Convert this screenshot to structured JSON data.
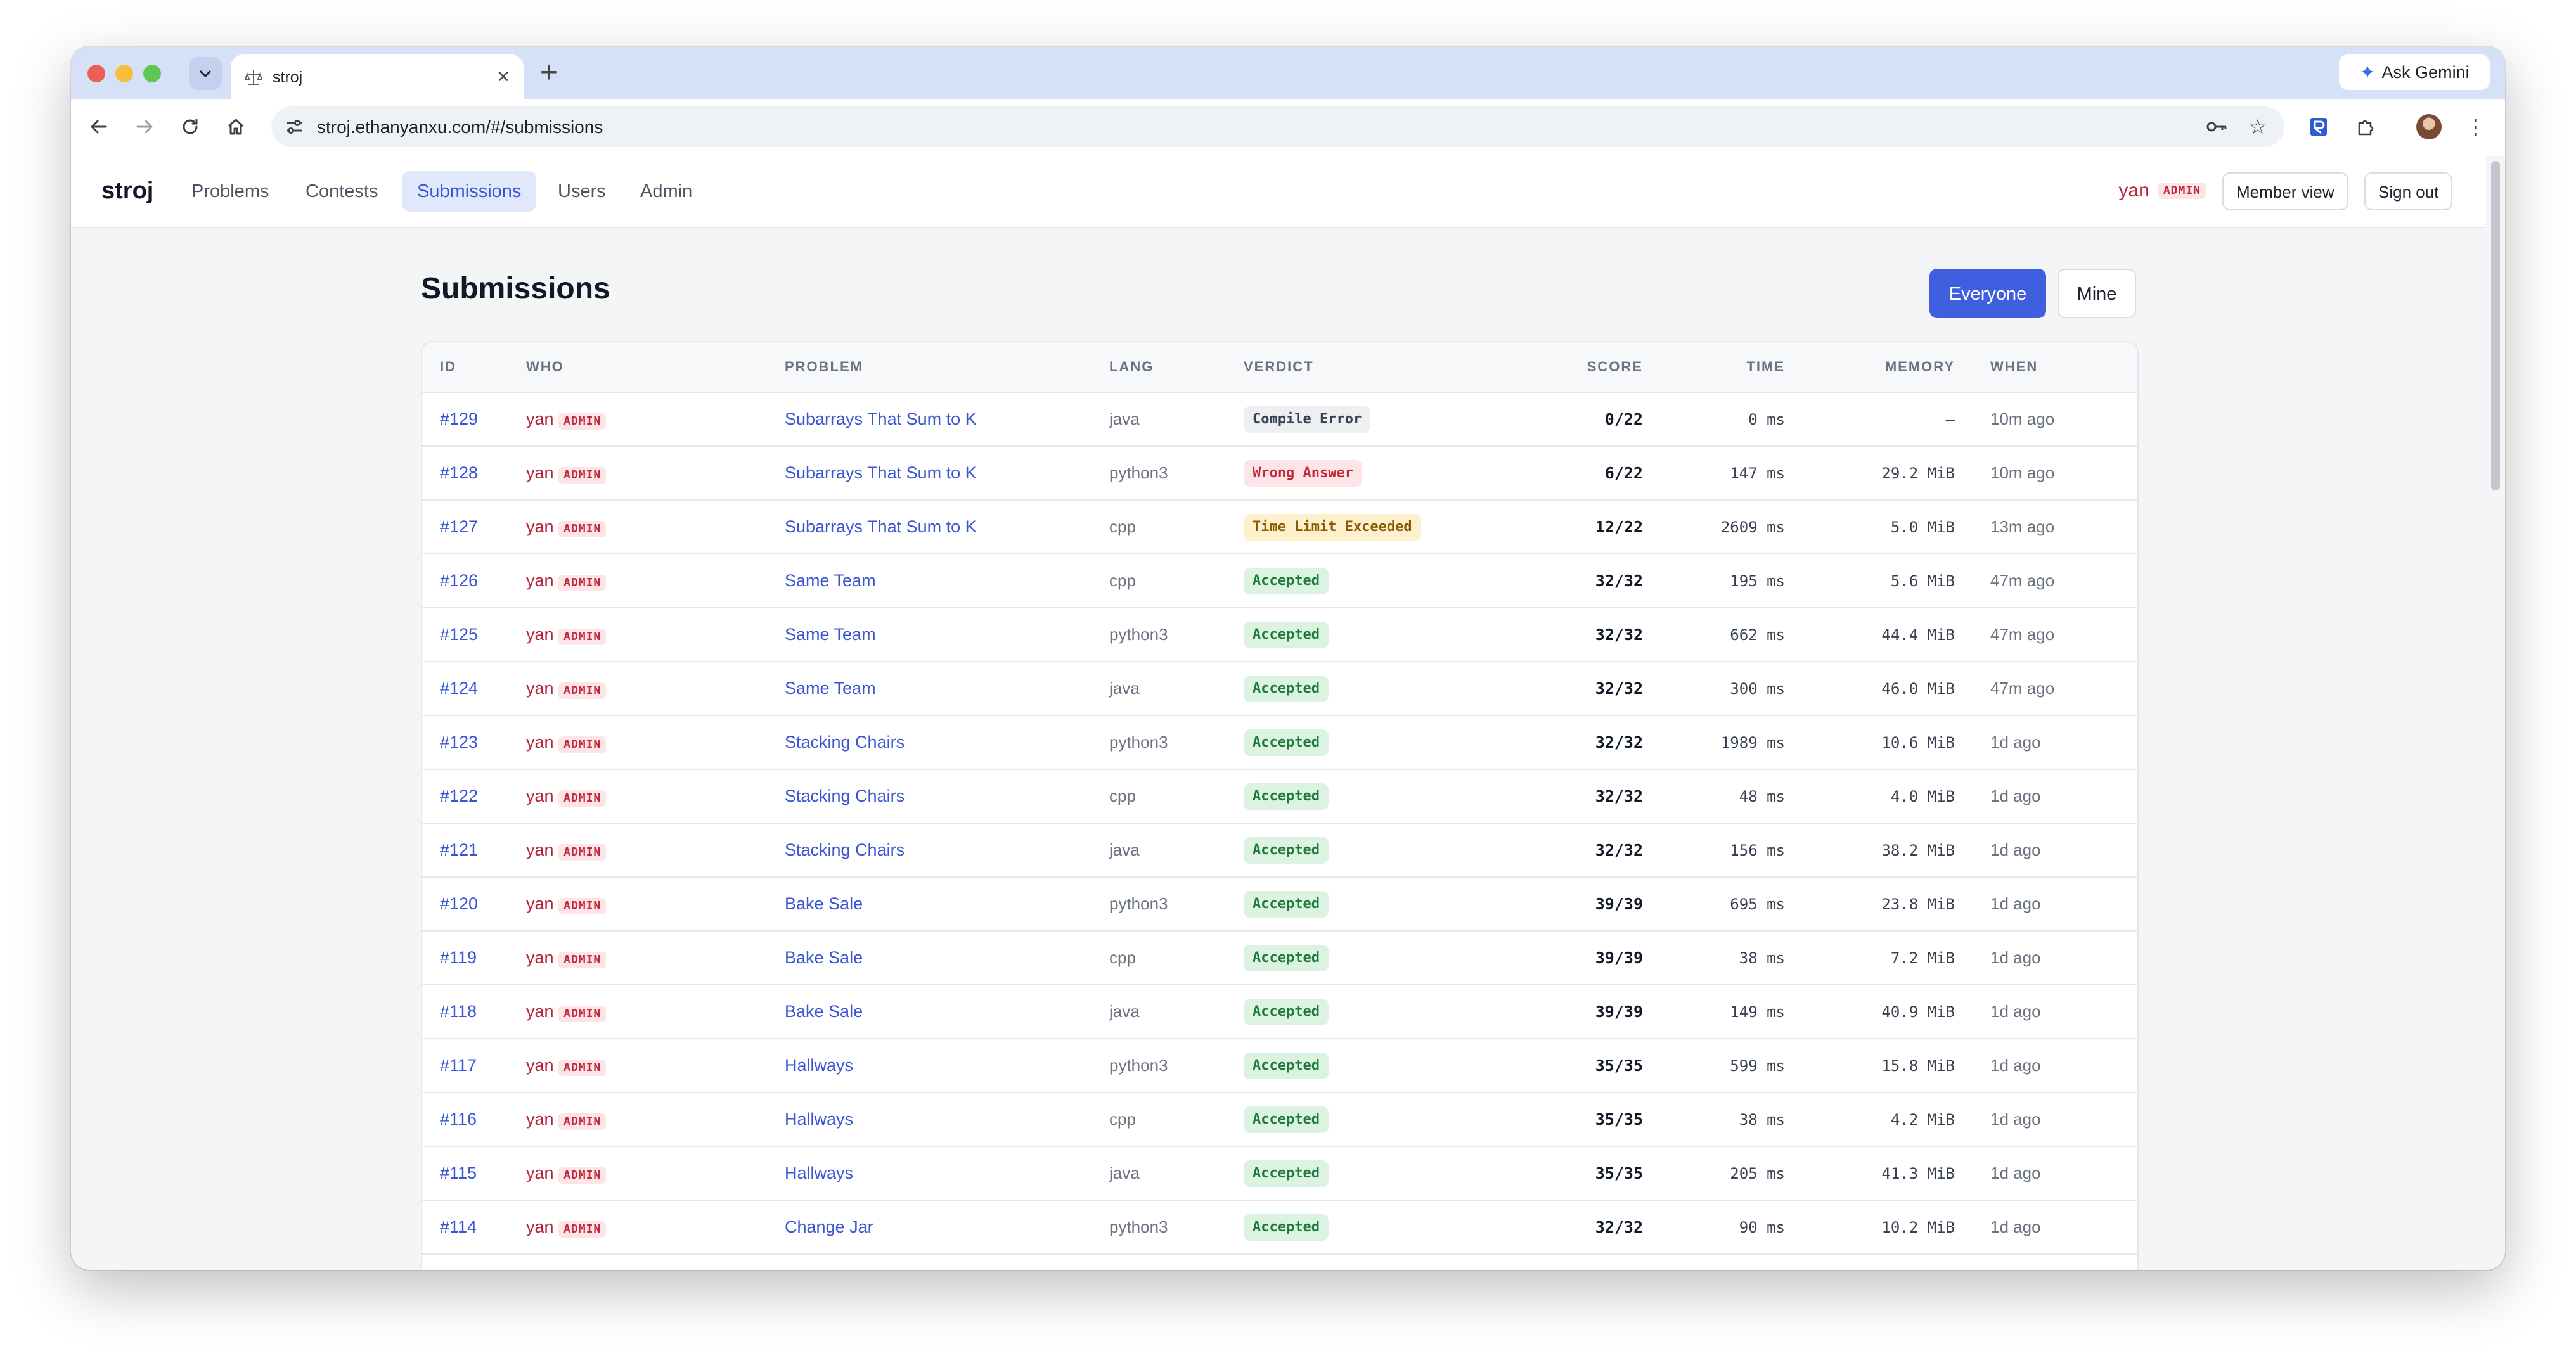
{
  "browser": {
    "tab_title": "stroj",
    "url": "stroj.ethanyanxu.com/#/submissions",
    "ask_gemini_label": "Ask Gemini",
    "new_tab_label": "+",
    "close_tab_label": "×"
  },
  "app": {
    "brand": "stroj",
    "nav": [
      "Problems",
      "Contests",
      "Submissions",
      "Users",
      "Admin"
    ],
    "active_nav": "Submissions",
    "user_name": "yan",
    "user_role_badge": "ADMIN",
    "member_view_label": "Member view",
    "sign_out_label": "Sign out"
  },
  "page": {
    "title": "Submissions",
    "filter_everyone": "Everyone",
    "filter_mine": "Mine",
    "active_filter": "Everyone"
  },
  "table": {
    "headers": {
      "id": "ID",
      "who": "WHO",
      "problem": "PROBLEM",
      "lang": "LANG",
      "verdict": "VERDICT",
      "score": "SCORE",
      "time": "TIME",
      "memory": "MEMORY",
      "when": "WHEN"
    },
    "rows": [
      {
        "id": "#129",
        "who": "yan",
        "badge": "ADMIN",
        "problem": "Subarrays That Sum to K",
        "lang": "java",
        "verdict": "Compile Error",
        "score": "0/22",
        "time": "0 ms",
        "memory": "—",
        "when": "10m ago"
      },
      {
        "id": "#128",
        "who": "yan",
        "badge": "ADMIN",
        "problem": "Subarrays That Sum to K",
        "lang": "python3",
        "verdict": "Wrong Answer",
        "score": "6/22",
        "time": "147 ms",
        "memory": "29.2 MiB",
        "when": "10m ago"
      },
      {
        "id": "#127",
        "who": "yan",
        "badge": "ADMIN",
        "problem": "Subarrays That Sum to K",
        "lang": "cpp",
        "verdict": "Time Limit Exceeded",
        "score": "12/22",
        "time": "2609 ms",
        "memory": "5.0 MiB",
        "when": "13m ago"
      },
      {
        "id": "#126",
        "who": "yan",
        "badge": "ADMIN",
        "problem": "Same Team",
        "lang": "cpp",
        "verdict": "Accepted",
        "score": "32/32",
        "time": "195 ms",
        "memory": "5.6 MiB",
        "when": "47m ago"
      },
      {
        "id": "#125",
        "who": "yan",
        "badge": "ADMIN",
        "problem": "Same Team",
        "lang": "python3",
        "verdict": "Accepted",
        "score": "32/32",
        "time": "662 ms",
        "memory": "44.4 MiB",
        "when": "47m ago"
      },
      {
        "id": "#124",
        "who": "yan",
        "badge": "ADMIN",
        "problem": "Same Team",
        "lang": "java",
        "verdict": "Accepted",
        "score": "32/32",
        "time": "300 ms",
        "memory": "46.0 MiB",
        "when": "47m ago"
      },
      {
        "id": "#123",
        "who": "yan",
        "badge": "ADMIN",
        "problem": "Stacking Chairs",
        "lang": "python3",
        "verdict": "Accepted",
        "score": "32/32",
        "time": "1989 ms",
        "memory": "10.6 MiB",
        "when": "1d ago"
      },
      {
        "id": "#122",
        "who": "yan",
        "badge": "ADMIN",
        "problem": "Stacking Chairs",
        "lang": "cpp",
        "verdict": "Accepted",
        "score": "32/32",
        "time": "48 ms",
        "memory": "4.0 MiB",
        "when": "1d ago"
      },
      {
        "id": "#121",
        "who": "yan",
        "badge": "ADMIN",
        "problem": "Stacking Chairs",
        "lang": "java",
        "verdict": "Accepted",
        "score": "32/32",
        "time": "156 ms",
        "memory": "38.2 MiB",
        "when": "1d ago"
      },
      {
        "id": "#120",
        "who": "yan",
        "badge": "ADMIN",
        "problem": "Bake Sale",
        "lang": "python3",
        "verdict": "Accepted",
        "score": "39/39",
        "time": "695 ms",
        "memory": "23.8 MiB",
        "when": "1d ago"
      },
      {
        "id": "#119",
        "who": "yan",
        "badge": "ADMIN",
        "problem": "Bake Sale",
        "lang": "cpp",
        "verdict": "Accepted",
        "score": "39/39",
        "time": "38 ms",
        "memory": "7.2 MiB",
        "when": "1d ago"
      },
      {
        "id": "#118",
        "who": "yan",
        "badge": "ADMIN",
        "problem": "Bake Sale",
        "lang": "java",
        "verdict": "Accepted",
        "score": "39/39",
        "time": "149 ms",
        "memory": "40.9 MiB",
        "when": "1d ago"
      },
      {
        "id": "#117",
        "who": "yan",
        "badge": "ADMIN",
        "problem": "Hallways",
        "lang": "python3",
        "verdict": "Accepted",
        "score": "35/35",
        "time": "599 ms",
        "memory": "15.8 MiB",
        "when": "1d ago"
      },
      {
        "id": "#116",
        "who": "yan",
        "badge": "ADMIN",
        "problem": "Hallways",
        "lang": "cpp",
        "verdict": "Accepted",
        "score": "35/35",
        "time": "38 ms",
        "memory": "4.2 MiB",
        "when": "1d ago"
      },
      {
        "id": "#115",
        "who": "yan",
        "badge": "ADMIN",
        "problem": "Hallways",
        "lang": "java",
        "verdict": "Accepted",
        "score": "35/35",
        "time": "205 ms",
        "memory": "41.3 MiB",
        "when": "1d ago"
      },
      {
        "id": "#114",
        "who": "yan",
        "badge": "ADMIN",
        "problem": "Change Jar",
        "lang": "python3",
        "verdict": "Accepted",
        "score": "32/32",
        "time": "90 ms",
        "memory": "10.2 MiB",
        "when": "1d ago"
      }
    ]
  },
  "colors": {
    "accent": "#3f5fe0",
    "link": "#3955d1",
    "admin_red": "#b4253b",
    "accepted_bg": "#dcf3e2",
    "accepted_fg": "#1e7a3c",
    "wrong_bg": "#fde4e6",
    "tle_bg": "#fdf0cd"
  },
  "icons": [
    "back-arrow-icon",
    "forward-arrow-icon",
    "reload-icon",
    "home-icon",
    "site-settings-icon",
    "password-key-icon",
    "bookmark-star-icon",
    "extension-icon",
    "puzzle-icon",
    "profile-avatar",
    "kebab-menu-icon",
    "sparkle-icon",
    "chevron-down-icon",
    "scale-favicon"
  ]
}
